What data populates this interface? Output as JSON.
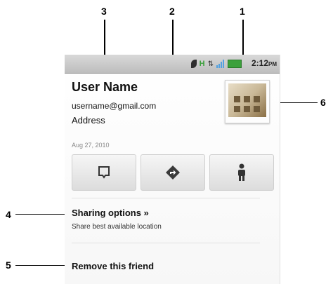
{
  "status_bar": {
    "network_label": "H",
    "time": "2:12",
    "ampm": "PM"
  },
  "profile": {
    "name": "User Name",
    "email": "username@gmail.com",
    "address": "Address",
    "timestamp": "Aug 27, 2010"
  },
  "actions": {
    "message_icon": "message-icon",
    "directions_icon": "directions-icon",
    "person_icon": "person-icon"
  },
  "sharing": {
    "title": "Sharing options »",
    "subtitle": "Share best available location"
  },
  "remove": {
    "label": "Remove this friend"
  },
  "callouts": {
    "c1": "1",
    "c2": "2",
    "c3": "3",
    "c4": "4",
    "c5": "5",
    "c6": "6"
  }
}
